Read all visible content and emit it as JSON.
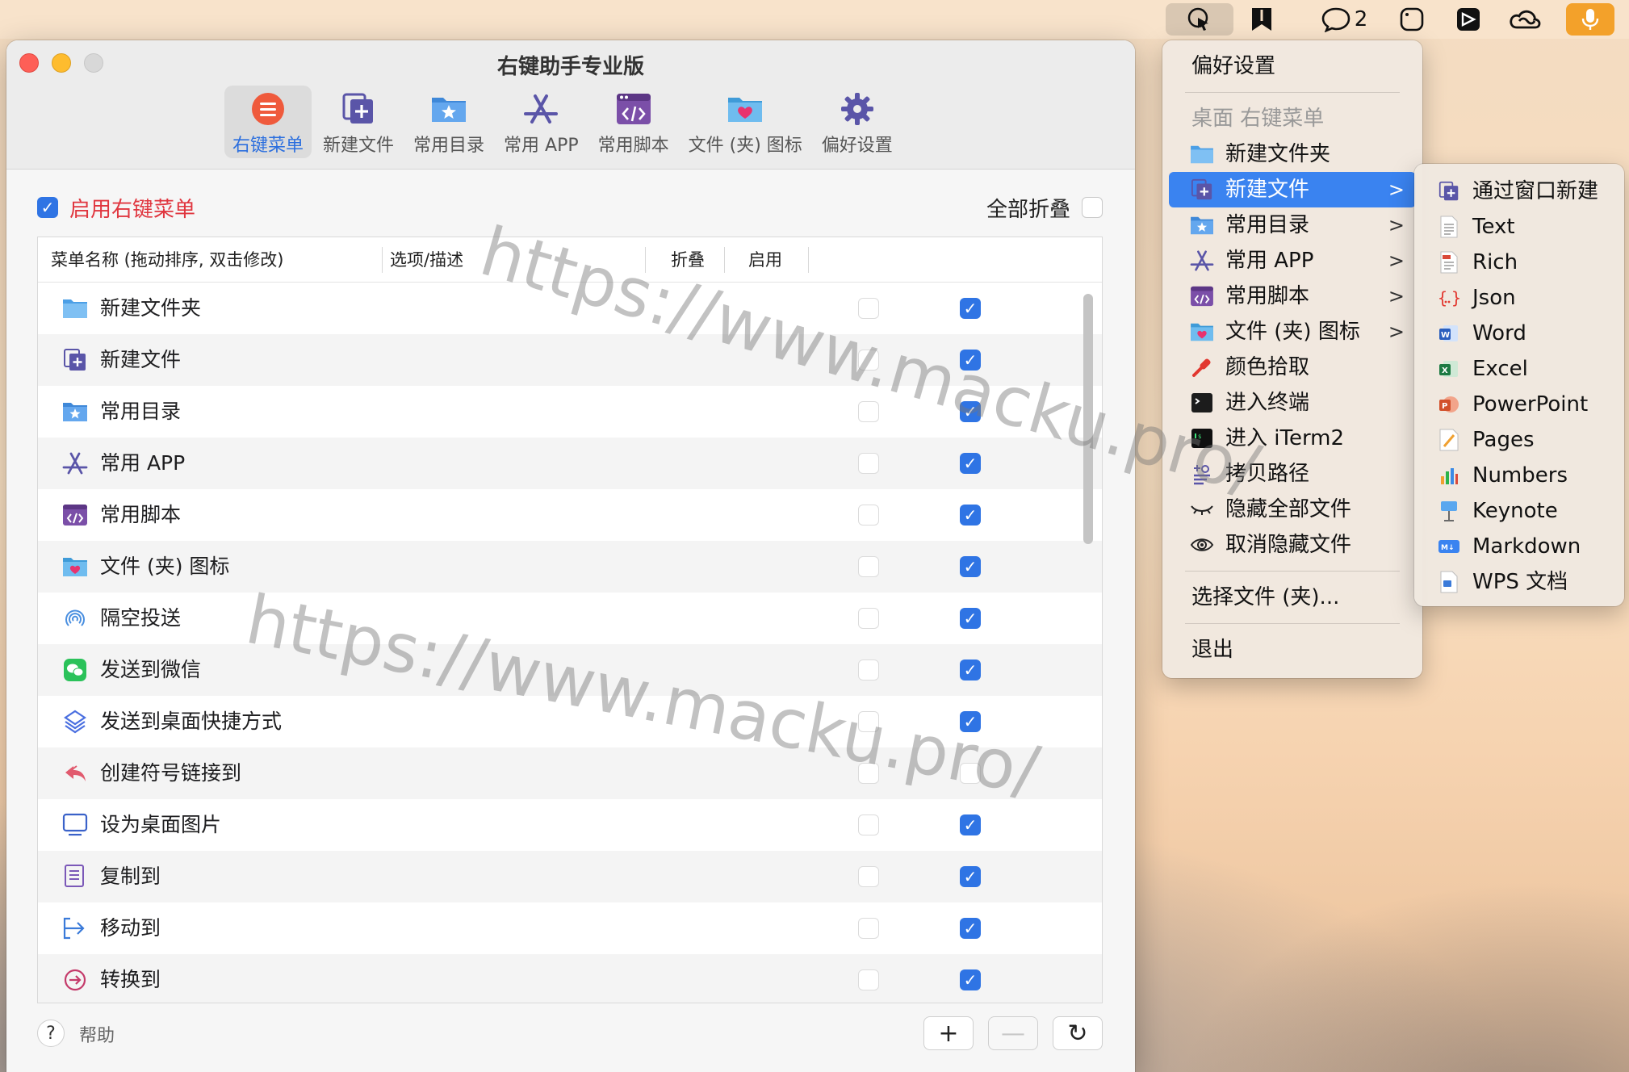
{
  "menubar": {
    "notification_count": "2"
  },
  "window": {
    "title": "右键助手专业版",
    "toolbar": [
      {
        "label": "右键菜单"
      },
      {
        "label": "新建文件"
      },
      {
        "label": "常用目录"
      },
      {
        "label": "常用 APP"
      },
      {
        "label": "常用脚本"
      },
      {
        "label": "文件 (夹) 图标"
      },
      {
        "label": "偏好设置"
      }
    ],
    "enable_label": "启用右键菜单",
    "fold_all_label": "全部折叠",
    "table": {
      "col_name": "菜单名称 (拖动排序, 双击修改)",
      "col_desc": "选项/描述",
      "col_fold": "折叠",
      "col_enable": "启用",
      "rows": [
        {
          "label": "新建文件夹"
        },
        {
          "label": "新建文件"
        },
        {
          "label": "常用目录"
        },
        {
          "label": "常用 APP"
        },
        {
          "label": "常用脚本"
        },
        {
          "label": "文件 (夹) 图标"
        },
        {
          "label": "隔空投送"
        },
        {
          "label": "发送到微信"
        },
        {
          "label": "发送到桌面快捷方式"
        },
        {
          "label": "创建符号链接到"
        },
        {
          "label": "设为桌面图片"
        },
        {
          "label": "复制到"
        },
        {
          "label": "移动到"
        },
        {
          "label": "转换到"
        }
      ]
    },
    "help_label": "帮助",
    "add_label": "+",
    "remove_label": "—",
    "refresh_label": "↻"
  },
  "menu": {
    "preferences": "偏好设置",
    "header": "桌面 右键菜单",
    "items": [
      {
        "label": "新建文件夹"
      },
      {
        "label": "新建文件"
      },
      {
        "label": "常用目录"
      },
      {
        "label": "常用 APP"
      },
      {
        "label": "常用脚本"
      },
      {
        "label": "文件 (夹) 图标"
      },
      {
        "label": "颜色拾取"
      },
      {
        "label": "进入终端"
      },
      {
        "label": "进入 iTerm2"
      },
      {
        "label": "拷贝路径"
      },
      {
        "label": "隐藏全部文件"
      },
      {
        "label": "取消隐藏文件"
      }
    ],
    "choose_file": "选择文件 (夹)...",
    "quit": "退出"
  },
  "submenu": {
    "items": [
      {
        "label": "通过窗口新建"
      },
      {
        "label": "Text"
      },
      {
        "label": "Rich"
      },
      {
        "label": "Json"
      },
      {
        "label": "Word"
      },
      {
        "label": "Excel"
      },
      {
        "label": "PowerPoint"
      },
      {
        "label": "Pages"
      },
      {
        "label": "Numbers"
      },
      {
        "label": "Keynote"
      },
      {
        "label": "Markdown"
      },
      {
        "label": "WPS 文档"
      }
    ]
  },
  "watermark": "https://www.macku.pro/",
  "colors": {
    "accent_blue": "#2f74e4",
    "enable_red": "#e0363f",
    "menu_highlight": "#3a83f0"
  }
}
